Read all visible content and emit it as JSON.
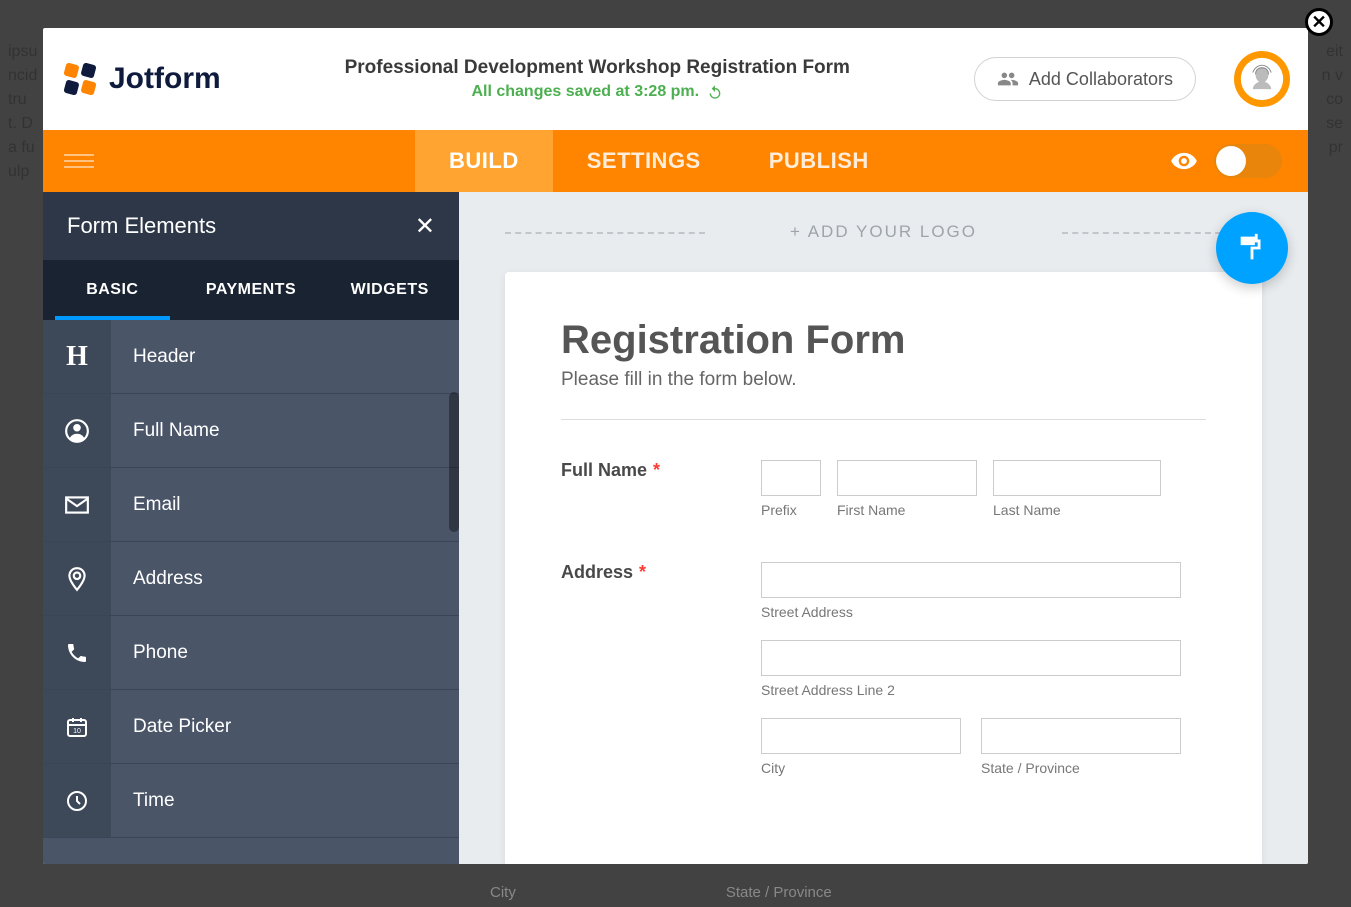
{
  "brand": "Jotform",
  "header": {
    "form_title": "Professional Development Workshop Registration Form",
    "save_status": "All changes saved at 3:28 pm.",
    "collaborators_label": "Add Collaborators"
  },
  "nav": {
    "tabs": [
      "BUILD",
      "SETTINGS",
      "PUBLISH"
    ],
    "active": "BUILD"
  },
  "sidebar": {
    "title": "Form Elements",
    "tabs": [
      "BASIC",
      "PAYMENTS",
      "WIDGETS"
    ],
    "active": "BASIC",
    "elements": [
      {
        "icon": "header-icon",
        "label": "Header"
      },
      {
        "icon": "user-icon",
        "label": "Full Name"
      },
      {
        "icon": "mail-icon",
        "label": "Email"
      },
      {
        "icon": "pin-icon",
        "label": "Address"
      },
      {
        "icon": "phone-icon",
        "label": "Phone"
      },
      {
        "icon": "calendar-icon",
        "label": "Date Picker"
      },
      {
        "icon": "clock-icon",
        "label": "Time"
      }
    ]
  },
  "canvas": {
    "add_logo": "+ ADD YOUR LOGO",
    "heading": "Registration Form",
    "subheading": "Please fill in the form below.",
    "fields": {
      "full_name": {
        "label": "Full Name",
        "required": true,
        "sub": {
          "prefix": "Prefix",
          "first": "First Name",
          "last": "Last Name"
        }
      },
      "address": {
        "label": "Address",
        "required": true,
        "sub": {
          "street": "Street Address",
          "street2": "Street Address Line 2",
          "city": "City",
          "state": "State / Province"
        }
      }
    }
  },
  "bg_labels": {
    "city": "City",
    "state": "State / Province"
  }
}
